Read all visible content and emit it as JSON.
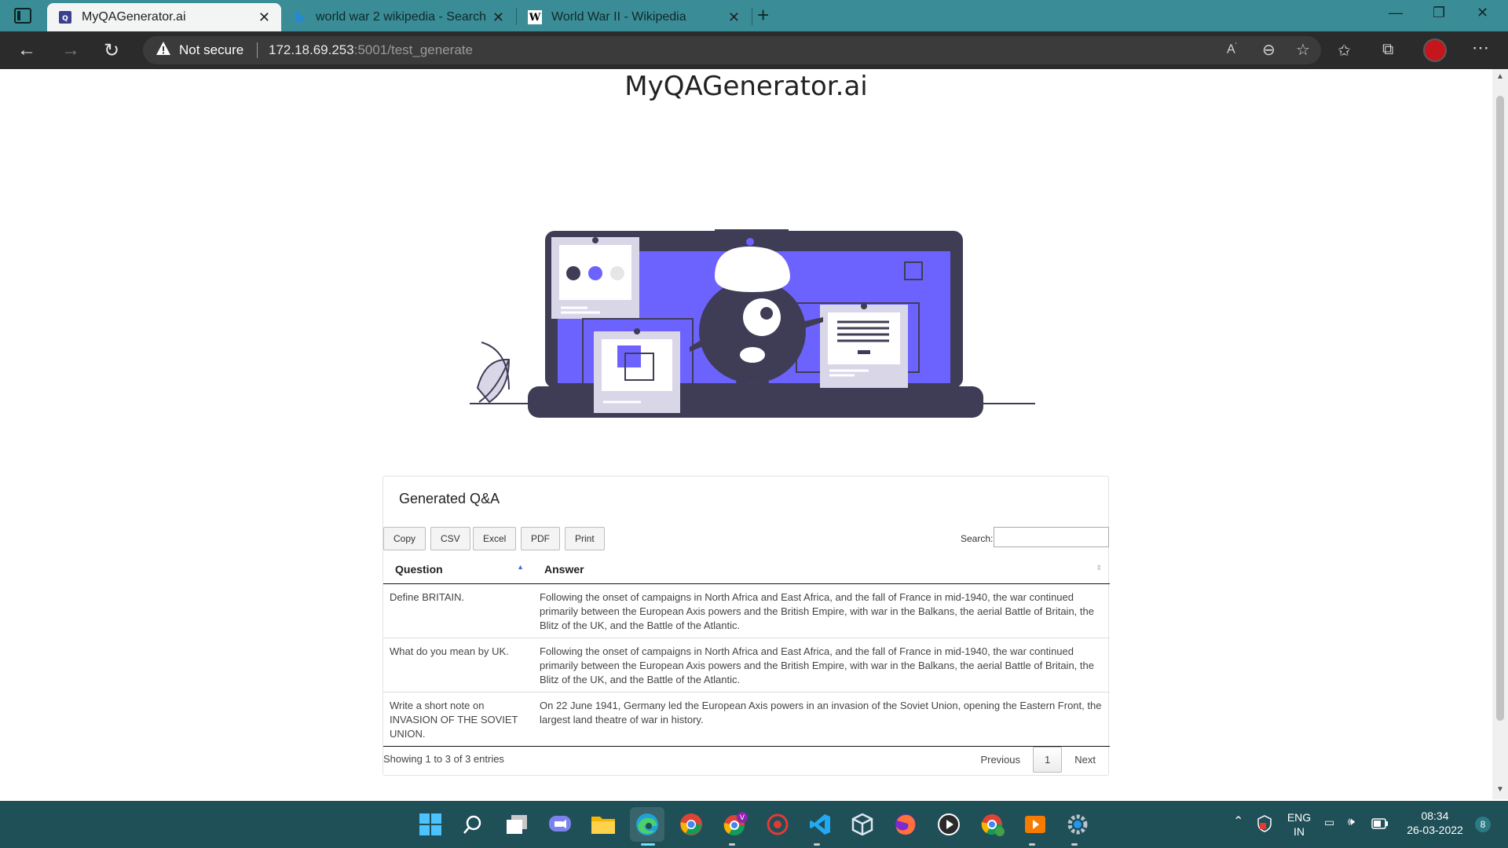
{
  "browser": {
    "tabs": [
      {
        "title": "MyQAGenerator.ai",
        "active": true,
        "favicon": "qa-favicon"
      },
      {
        "title": "world war 2 wikipedia - Search",
        "active": false,
        "favicon": "bing-icon"
      },
      {
        "title": "World War II - Wikipedia",
        "active": false,
        "favicon": "wikipedia-icon",
        "favicon_letter": "W"
      }
    ],
    "tab_bar_color": "#3a8d96",
    "security_label": "Not secure",
    "url_host": "172.18.69.253",
    "url_rest": ":5001/test_generate"
  },
  "site": {
    "title": "MyQAGenerator.ai",
    "accent_color": "#6c63ff"
  },
  "qa_card": {
    "title": "Generated Q&A",
    "buttons": [
      "Copy",
      "CSV",
      "Excel",
      "PDF",
      "Print"
    ],
    "search_label": "Search:",
    "search_value": "",
    "columns": [
      "Question",
      "Answer"
    ],
    "sort_column": "Question",
    "sort_direction": "ascending",
    "rows": [
      {
        "question": "Define BRITAIN.",
        "answer": "Following the onset of campaigns in North Africa and East Africa, and the fall of France in mid-1940, the war continued primarily between the European Axis powers and the British Empire, with war in the Balkans, the aerial Battle of Britain, the Blitz of the UK, and the Battle of the Atlantic."
      },
      {
        "question": "What do you mean by UK.",
        "answer": "Following the onset of campaigns in North Africa and East Africa, and the fall of France in mid-1940, the war continued primarily between the European Axis powers and the British Empire, with war in the Balkans, the aerial Battle of Britain, the Blitz of the UK, and the Battle of the Atlantic."
      },
      {
        "question": "Write a short note on INVASION OF THE SOVIET UNION.",
        "answer": "On 22 June 1941, Germany led the European Axis powers in an invasion of the Soviet Union, opening the Eastern Front, the largest land theatre of war in history."
      }
    ],
    "info": "Showing 1 to 3 of 3 entries",
    "pagination": {
      "previous": "Previous",
      "current": "1",
      "next": "Next"
    }
  },
  "taskbar": {
    "apps": [
      "start-icon",
      "search-icon",
      "task-view-icon",
      "chat-icon",
      "file-explorer-icon",
      "edge-icon",
      "chrome-icon",
      "chrome-profile-icon",
      "record-icon",
      "vscode-icon",
      "virtualbox-icon",
      "firefox-icon",
      "media-player-icon",
      "chrome-icon",
      "vlc-icon",
      "settings-icon"
    ],
    "language_line1": "ENG",
    "language_line2": "IN",
    "time": "08:34",
    "date": "26-03-2022",
    "notification_count": "8"
  }
}
